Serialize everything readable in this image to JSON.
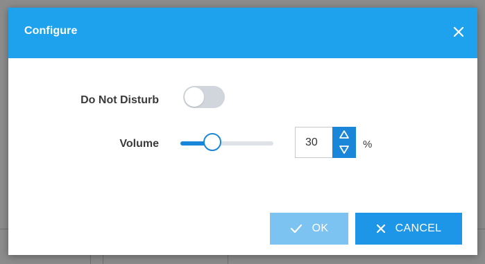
{
  "dialog": {
    "title": "Configure",
    "close_icon": "close-icon"
  },
  "settings": {
    "do_not_disturb": {
      "label": "Do Not Disturb",
      "enabled": false
    },
    "volume": {
      "label": "Volume",
      "value": "30",
      "level_fraction": 0.3,
      "unit": "%"
    }
  },
  "footer": {
    "ok_label": "OK",
    "ok_icon": "check-icon",
    "cancel_label": "CANCEL",
    "cancel_icon": "x-icon"
  },
  "colors": {
    "header": "#1ea2ed",
    "accent": "#1a86d9",
    "ok_disabled": "#7cc3f1",
    "cancel": "#1e96e8",
    "toggle_off": "#d1d6dc"
  }
}
